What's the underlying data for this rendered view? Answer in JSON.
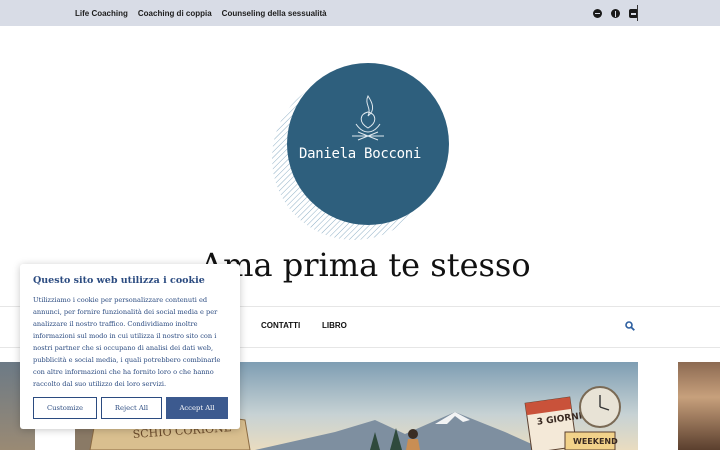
{
  "topbar": {
    "nav": [
      "Life Coaching",
      "Coaching di coppia",
      "Counseling della sessualità"
    ],
    "social_icons": [
      "spotify-icon",
      "pinterest-icon",
      "substack-icon"
    ]
  },
  "logo": {
    "text": "Daniela Bocconi"
  },
  "site_title": "Ama prima te stesso",
  "mainnav": {
    "items": [
      "CONTATTI",
      "LIBRO"
    ],
    "search_icon": "search-icon"
  },
  "hero": {
    "sign_text": "SCHIO CORIONE",
    "calendar_text": "3 GIORNI",
    "weekend_text": "WEEKEND"
  },
  "cookie": {
    "title": "Questo sito web utilizza i cookie",
    "lines": [
      "Utilizziamo i cookie per personalizzare contenuti ed",
      "annunci, per fornire funzionalità dei social media e per",
      "analizzare il nostro traffico. Condividiamo inoltre",
      "informazioni sul modo in cui utilizza il nostro sito con i",
      "nostri partner che si occupano di analisi dei dati web,",
      "pubblicità e social media, i quali potrebbero combinarle",
      "con altre informazioni che ha fornito loro o che hanno",
      "raccolto dal suo utilizzo dei loro servizi."
    ],
    "customize": "Customize",
    "reject": "Reject All",
    "accept": "Accept All"
  },
  "colors": {
    "topbar": "#d8dce6",
    "logo_circle": "#2e5f7d",
    "cookie_accent": "#2b4b80",
    "accept_bg": "#3c5a8f"
  }
}
